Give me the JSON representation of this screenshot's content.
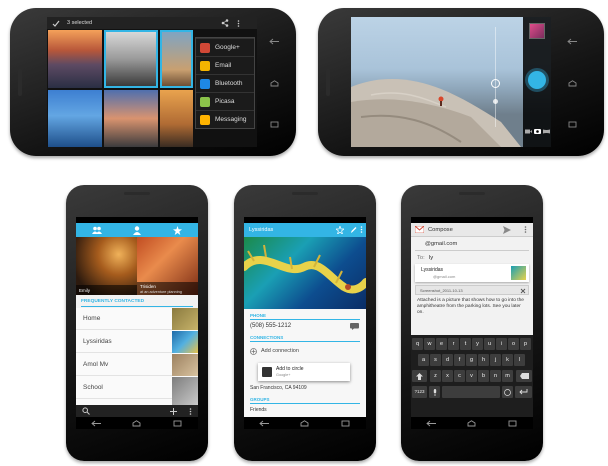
{
  "phone_gallery": {
    "selected_label": "3 selected",
    "share_menu": [
      {
        "label": "Google+",
        "color": "#d14836"
      },
      {
        "label": "Email",
        "color": "#f4b400"
      },
      {
        "label": "Bluetooth",
        "color": "#1e88e5"
      },
      {
        "label": "Picasa",
        "color": "#8bc34a"
      },
      {
        "label": "Messaging",
        "color": "#ffb300"
      }
    ]
  },
  "phone_people": {
    "section_header": "FREQUENTLY CONTACTED",
    "tile_left": "Emily",
    "tile_right_name": "Trisiden",
    "tile_right_status": "at an adventure planning",
    "contacts": [
      "Home",
      "Lyssiridas",
      "Amol Mv",
      "School"
    ]
  },
  "phone_contact": {
    "name": "Lyssiridas",
    "section_phone": "PHONE",
    "phone_number": "(508) 555-1212",
    "section_connections": "CONNECTIONS",
    "add_connection_label": "Add connection",
    "add_to_circle_label": "Add to circle",
    "add_to_circle_sub": "Google+",
    "address": "San Francisco, CA 94109",
    "section_groups": "GROUPS",
    "groups_value": "Friends"
  },
  "phone_compose": {
    "title": "Compose",
    "from_value": "@gmail.com",
    "to_label": "To:",
    "to_value": "ly",
    "suggestion_name": "Lyssiridas",
    "suggestion_email": "@gmail.com",
    "attachment_name": "Screenshot_2011-10-13",
    "body_text": "Attached is a picture that shows how to go into the amphitheatre from the parking lots. See you later on.",
    "keyboard_rows": [
      [
        "q",
        "w",
        "e",
        "r",
        "t",
        "y",
        "u",
        "i",
        "o",
        "p"
      ],
      [
        "a",
        "s",
        "d",
        "f",
        "g",
        "h",
        "j",
        "k",
        "l"
      ],
      [
        "z",
        "x",
        "c",
        "v",
        "b",
        "n",
        "m"
      ]
    ],
    "sym_key": "?123"
  },
  "colors": {
    "holo_blue": "#33b5e5",
    "gmail_red": "#d14836",
    "dark_bar": "#222222"
  }
}
